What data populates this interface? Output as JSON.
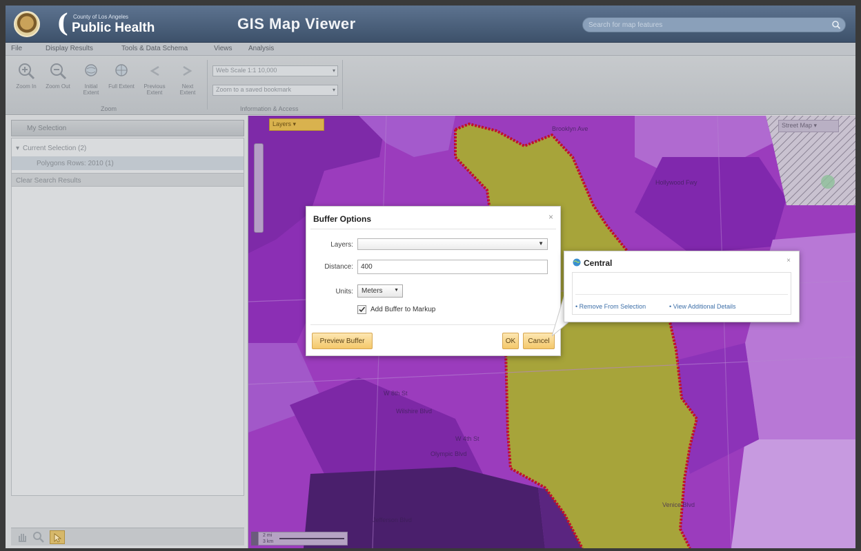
{
  "header": {
    "logo_small": "County of Los Angeles",
    "logo_big": "Public Health",
    "app_title": "GIS Map Viewer",
    "search_placeholder": "Search for map features"
  },
  "menubar": {
    "items": [
      "File",
      "Display Results",
      "Tools & Data Schema",
      "Views",
      "Analysis"
    ]
  },
  "ribbon": {
    "tools": [
      "Zoom In",
      "Zoom Out",
      "Initial Extent",
      "Full Extent",
      "Previous Extent",
      "Next Extent"
    ],
    "group_label_left": "Zoom",
    "select_1": "Web Scale 1:1 10,000",
    "select_2": "Zoom to a saved bookmark",
    "group_label_right": "Information & Access"
  },
  "leftpanel": {
    "header": "My Selection",
    "tree": [
      {
        "label": "Current Selection (2)"
      },
      {
        "label": "Polygons Rows: 2010 (1)"
      },
      {
        "label": "Clear Search Results"
      }
    ]
  },
  "map": {
    "chip_label": "Layers ▾",
    "basemap_label": "Street Map ▾",
    "labels": [
      {
        "text": "Brooklyn Ave"
      },
      {
        "text": "Hollywood Fwy"
      },
      {
        "text": "W 8th St"
      },
      {
        "text": "Wilshire Blvd"
      },
      {
        "text": "W 4th St"
      },
      {
        "text": "Olympic Blvd"
      },
      {
        "text": "Jefferson Blvd"
      },
      {
        "text": "Venice Blvd"
      }
    ],
    "scale": {
      "top": "2 mi",
      "bottom": "3 km"
    }
  },
  "dialog": {
    "title": "Buffer Options",
    "close": "×",
    "layers_label": "Layers:",
    "layers_value": "",
    "distance_label": "Distance:",
    "distance_value": "400",
    "units_label": "Units:",
    "units_value": "Meters",
    "checkbox_label": "Add Buffer to Markup",
    "checkbox_checked": true,
    "preview_button": "Preview Buffer",
    "ok_button": "OK",
    "cancel_button": "Cancel"
  },
  "popup": {
    "title": "Central",
    "close": "×",
    "link_remove": "• Remove From Selection",
    "link_details": "• View Additional Details"
  },
  "colors": {
    "header_bg": "#4d627d",
    "map_purple": "#9a39b8",
    "selected_polygon": "#a8a53c",
    "boundary_red": "#c0112a",
    "button_orange": "#f4c86a",
    "link_blue": "#3d6fa8"
  }
}
